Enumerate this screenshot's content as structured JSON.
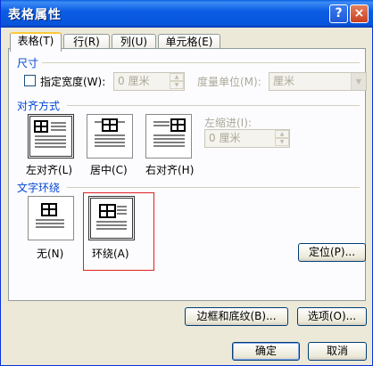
{
  "window": {
    "title": "表格属性"
  },
  "title_buttons": {
    "help": "?",
    "close": "×"
  },
  "tabs": [
    {
      "label": "表格(T)",
      "active": true
    },
    {
      "label": "行(R)",
      "active": false
    },
    {
      "label": "列(U)",
      "active": false
    },
    {
      "label": "单元格(E)",
      "active": false
    }
  ],
  "size": {
    "section_label": "尺寸",
    "preferred_width_label": "指定宽度(W):",
    "preferred_width_value": "0 厘米",
    "measure_label": "度量单位(M):",
    "measure_value": "厘米"
  },
  "alignment": {
    "section_label": "对齐方式",
    "options": [
      "左对齐(L)",
      "居中(C)",
      "右对齐(H)"
    ],
    "indent_label": "左缩进(I):",
    "indent_value": "0 厘米"
  },
  "wrapping": {
    "section_label": "文字环绕",
    "options": [
      "无(N)",
      "环绕(A)"
    ],
    "selected": "环绕(A)",
    "positioning_button": "定位(P)..."
  },
  "buttons": {
    "borders": "边框和底纹(B)...",
    "options": "选项(O)...",
    "ok": "确定",
    "cancel": "取消"
  }
}
